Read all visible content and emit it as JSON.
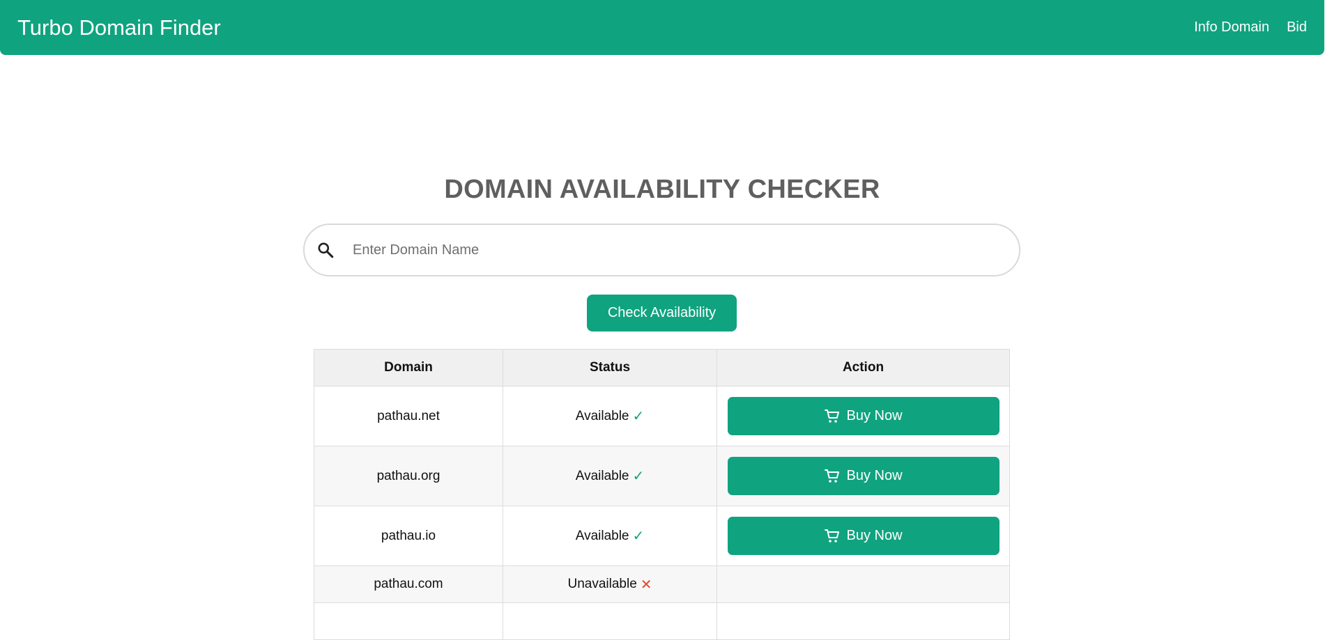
{
  "navbar": {
    "brand": "Turbo Domain Finder",
    "links": [
      "Info Domain",
      "Bid"
    ]
  },
  "main": {
    "title": "DOMAIN AVAILABILITY CHECKER",
    "search": {
      "placeholder": "Enter Domain Name",
      "value": ""
    },
    "check_button": "Check Availability"
  },
  "table": {
    "headers": [
      "Domain",
      "Status",
      "Action"
    ],
    "rows": [
      {
        "domain": "pathau.net",
        "status": "Available",
        "status_icon": "checkmark-icon",
        "action": "Buy Now"
      },
      {
        "domain": "pathau.org",
        "status": "Available",
        "status_icon": "checkmark-icon",
        "action": "Buy Now"
      },
      {
        "domain": "pathau.io",
        "status": "Available",
        "status_icon": "checkmark-icon",
        "action": "Buy Now"
      },
      {
        "domain": "pathau.com",
        "status": "Unavailable",
        "status_icon": "cross-icon",
        "action": ""
      }
    ]
  },
  "colors": {
    "accent": "#10a37f",
    "title": "#5f5f5f",
    "available": "#10a37f",
    "unavailable": "#e0492b"
  }
}
